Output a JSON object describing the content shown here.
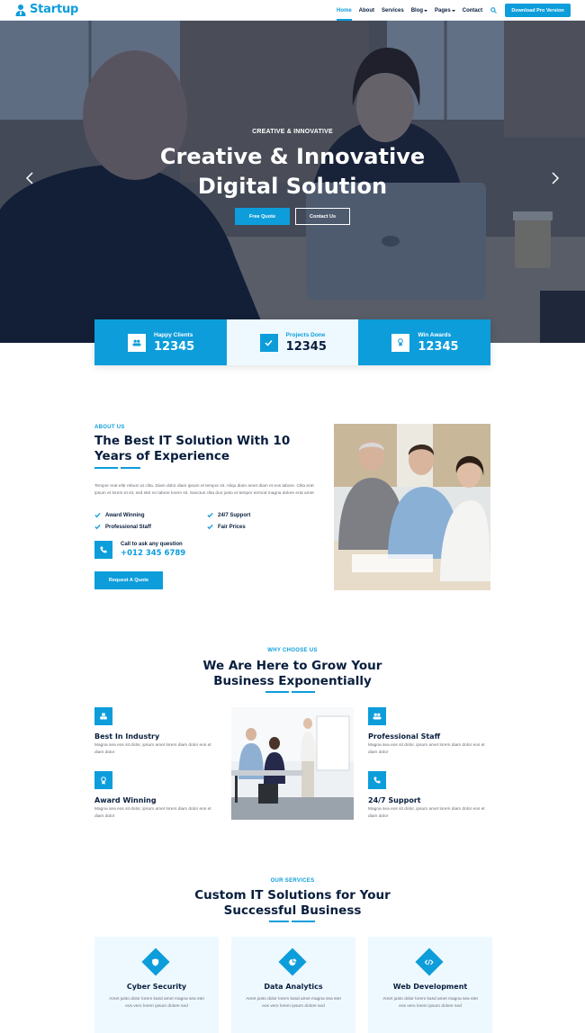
{
  "navbar": {
    "brand": "Startup",
    "links": [
      {
        "label": "Home",
        "active": true,
        "dropdown": false
      },
      {
        "label": "About",
        "active": false,
        "dropdown": false
      },
      {
        "label": "Services",
        "active": false,
        "dropdown": false
      },
      {
        "label": "Blog",
        "active": false,
        "dropdown": true
      },
      {
        "label": "Pages",
        "active": false,
        "dropdown": true
      },
      {
        "label": "Contact",
        "active": false,
        "dropdown": false
      }
    ],
    "cta": "Download Pro Version"
  },
  "hero": {
    "eyebrow": "CREATIVE & INNOVATIVE",
    "title_line1": "Creative & Innovative",
    "title_line2": "Digital Solution",
    "btn_primary": "Free Quote",
    "btn_secondary": "Contact Us"
  },
  "stats": [
    {
      "label": "Happy Clients",
      "value": "12345",
      "icon": "users-icon"
    },
    {
      "label": "Projects Done",
      "value": "12345",
      "icon": "check-icon"
    },
    {
      "label": "Win Awards",
      "value": "12345",
      "icon": "award-icon"
    }
  ],
  "about": {
    "eyebrow": "ABOUT US",
    "title": "The Best IT Solution With 10 Years of Experience",
    "text": "Tempor erat elitr rebum at clita. Diam dolor diam ipsum et tempor sit. Aliqu diam amet diam et eos labore. Clita erat ipsum et lorem et sit, sed stet no labore lorem sit. Sanctus clita duo justo et tempor eirmod magna dolore erat amet",
    "features": [
      "Award Winning",
      "24/7 Support",
      "Professional Staff",
      "Fair Prices"
    ],
    "call_label": "Call to ask any question",
    "call_number": "+012 345 6789",
    "button": "Request A Quote"
  },
  "why": {
    "eyebrow": "WHY CHOOSE US",
    "title_line1": "We Are Here to Grow Your",
    "title_line2": "Business Exponentially",
    "items": [
      {
        "title": "Best In Industry",
        "text": "Magna sea eos sit dolor, ipsum amet lorem diam dolor eos et diam dolor",
        "icon": "cubes-icon"
      },
      {
        "title": "Award Winning",
        "text": "Magna sea eos sit dolor, ipsum amet lorem diam dolor eos et diam dolor",
        "icon": "award-icon"
      },
      {
        "title": "Professional Staff",
        "text": "Magna sea eos sit dolor, ipsum amet lorem diam dolor eos et diam dolor",
        "icon": "users-icon"
      },
      {
        "title": "24/7 Support",
        "text": "Magna sea eos sit dolor, ipsum amet lorem diam dolor eos et diam dolor",
        "icon": "phone-icon"
      }
    ]
  },
  "services": {
    "eyebrow": "OUR SERVICES",
    "title_line1": "Custom IT Solutions for Your",
    "title_line2": "Successful Business",
    "cards": [
      {
        "title": "Cyber Security",
        "text": "Amet justo dolor lorem kasd amet magna sea stet eos vero lorem ipsum dolore sed",
        "icon": "shield-icon"
      },
      {
        "title": "Data Analytics",
        "text": "Amet justo dolor lorem kasd amet magna sea stet eos vero lorem ipsum dolore sed",
        "icon": "chart-icon"
      },
      {
        "title": "Web Development",
        "text": "Amet justo dolor lorem kasd amet magna sea stet eos vero lorem ipsum dolore sed",
        "icon": "code-icon"
      }
    ]
  }
}
